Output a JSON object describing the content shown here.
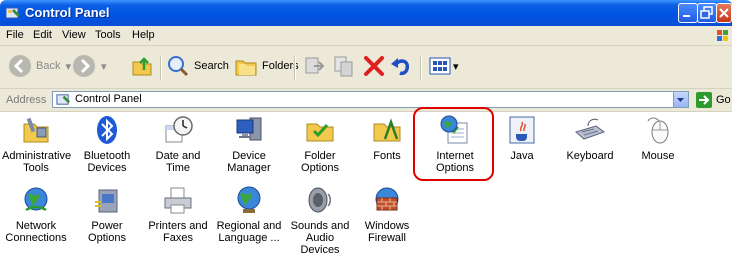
{
  "window": {
    "title": "Control Panel"
  },
  "menubar": {
    "items": [
      "File",
      "Edit",
      "View",
      "Tools",
      "Help"
    ]
  },
  "toolbar": {
    "back_label": "Back",
    "search_label": "Search",
    "folders_label": "Folders"
  },
  "address": {
    "label": "Address",
    "value": "Control Panel",
    "go_label": "Go"
  },
  "items": [
    {
      "label": "Administrative\nTools",
      "icon": "administrative-tools-icon"
    },
    {
      "label": "Bluetooth\nDevices",
      "icon": "bluetooth-icon"
    },
    {
      "label": "Date and Time",
      "icon": "date-time-icon"
    },
    {
      "label": "Device\nManager",
      "icon": "device-manager-icon"
    },
    {
      "label": "Folder Options",
      "icon": "folder-options-icon"
    },
    {
      "label": "Fonts",
      "icon": "fonts-icon"
    },
    {
      "label": "Internet\nOptions",
      "icon": "internet-options-icon",
      "highlighted": true
    },
    {
      "label": "Java",
      "icon": "java-icon"
    },
    {
      "label": "Keyboard",
      "icon": "keyboard-icon"
    },
    {
      "label": "Mouse",
      "icon": "mouse-icon"
    },
    {
      "label": "Network\nConnections",
      "icon": "network-connections-icon"
    },
    {
      "label": "Power Options",
      "icon": "power-options-icon"
    },
    {
      "label": "Printers and\nFaxes",
      "icon": "printers-faxes-icon"
    },
    {
      "label": "Regional and\nLanguage ...",
      "icon": "regional-language-icon"
    },
    {
      "label": "Sounds and\nAudio Devices",
      "icon": "sounds-audio-icon"
    },
    {
      "label": "Windows\nFirewall",
      "icon": "windows-firewall-icon"
    }
  ],
  "colors": {
    "titlebar": "#0054e3",
    "highlight": "#e00000",
    "chrome": "#ece9d8"
  }
}
